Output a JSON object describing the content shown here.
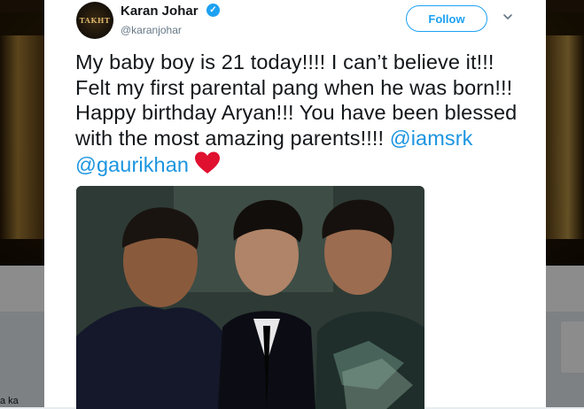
{
  "background": {
    "snippet_text": "a ka"
  },
  "tweet": {
    "author": {
      "display_name": "Karan Johar",
      "handle": "@karanjohar",
      "avatar_text": "TAKHT",
      "verified_icon": "verified-badge-icon"
    },
    "follow_label": "Follow",
    "menu_icon": "chevron-down-icon",
    "text_parts": {
      "body": "My baby boy is 21 today!!!! I can’t believe it!!! Felt my first parental pang when he was born!!! Happy birthday Aryan!!! You have been blessed with the most amazing parents!!!! ",
      "mention_1": "@iamsrk",
      "space": " ",
      "mention_2": "@gaurikhan",
      "emoji_icon": "red-heart-icon"
    },
    "photo_icon": "group-photo-image"
  },
  "colors": {
    "accent": "#1da1f2",
    "mention": "#1b95e0",
    "text": "#14171a",
    "secondary_text": "#657786",
    "heart": "#e0102f"
  }
}
